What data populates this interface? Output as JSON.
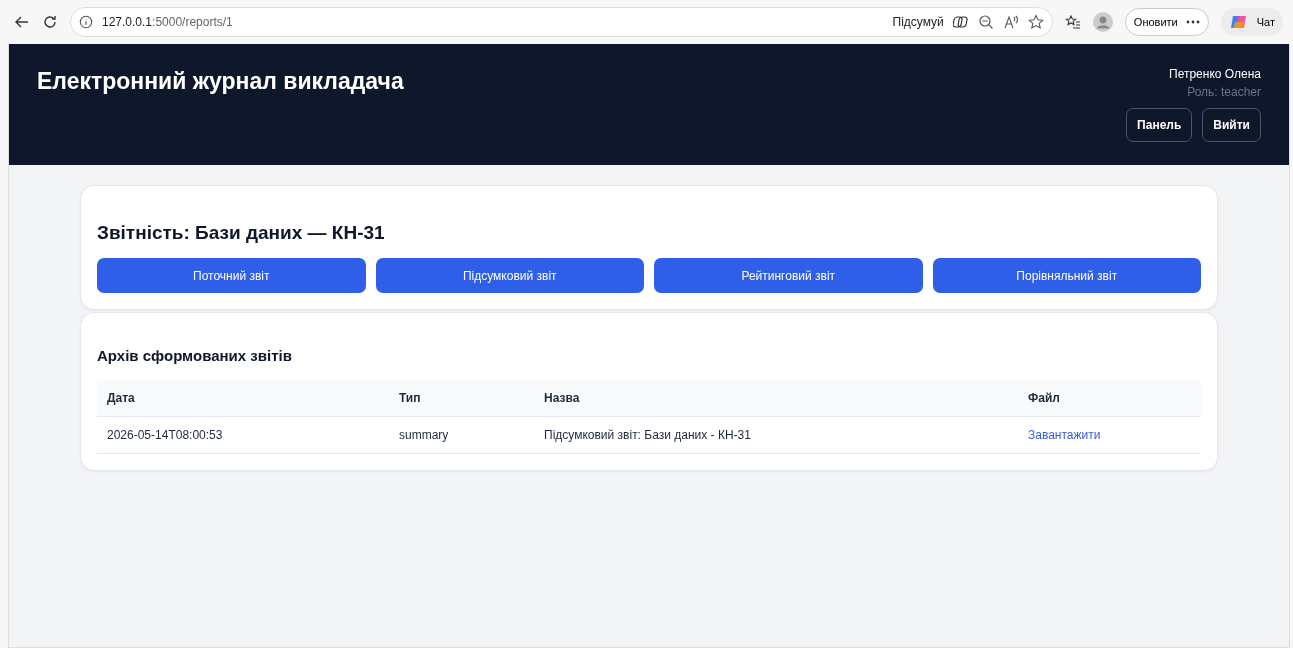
{
  "browser": {
    "url_host": "127.0.0.1",
    "url_path": ":5000/reports/1",
    "summarize_label": "Підсумуй",
    "update_label": "Оновити",
    "chat_label": "Чат"
  },
  "header": {
    "title": "Електронний журнал викладача",
    "user_name": "Петренко Олена",
    "user_role": "Роль: teacher",
    "buttons": [
      "Панель",
      "Вийти"
    ]
  },
  "reports": {
    "title": "Звітність: Бази даних — КН-31",
    "buttons": [
      "Поточний звіт",
      "Підсумковий звіт",
      "Рейтинговий звіт",
      "Порівняльний звіт"
    ]
  },
  "archive": {
    "title": "Архів сформованих звітів",
    "columns": [
      "Дата",
      "Тип",
      "Назва",
      "Файл"
    ],
    "rows": [
      {
        "date": "2026-05-14T08:00:53",
        "type": "summary",
        "name": "Підсумковий звіт: Бази даних - КН-31",
        "file_link": "Завантажити"
      }
    ]
  }
}
